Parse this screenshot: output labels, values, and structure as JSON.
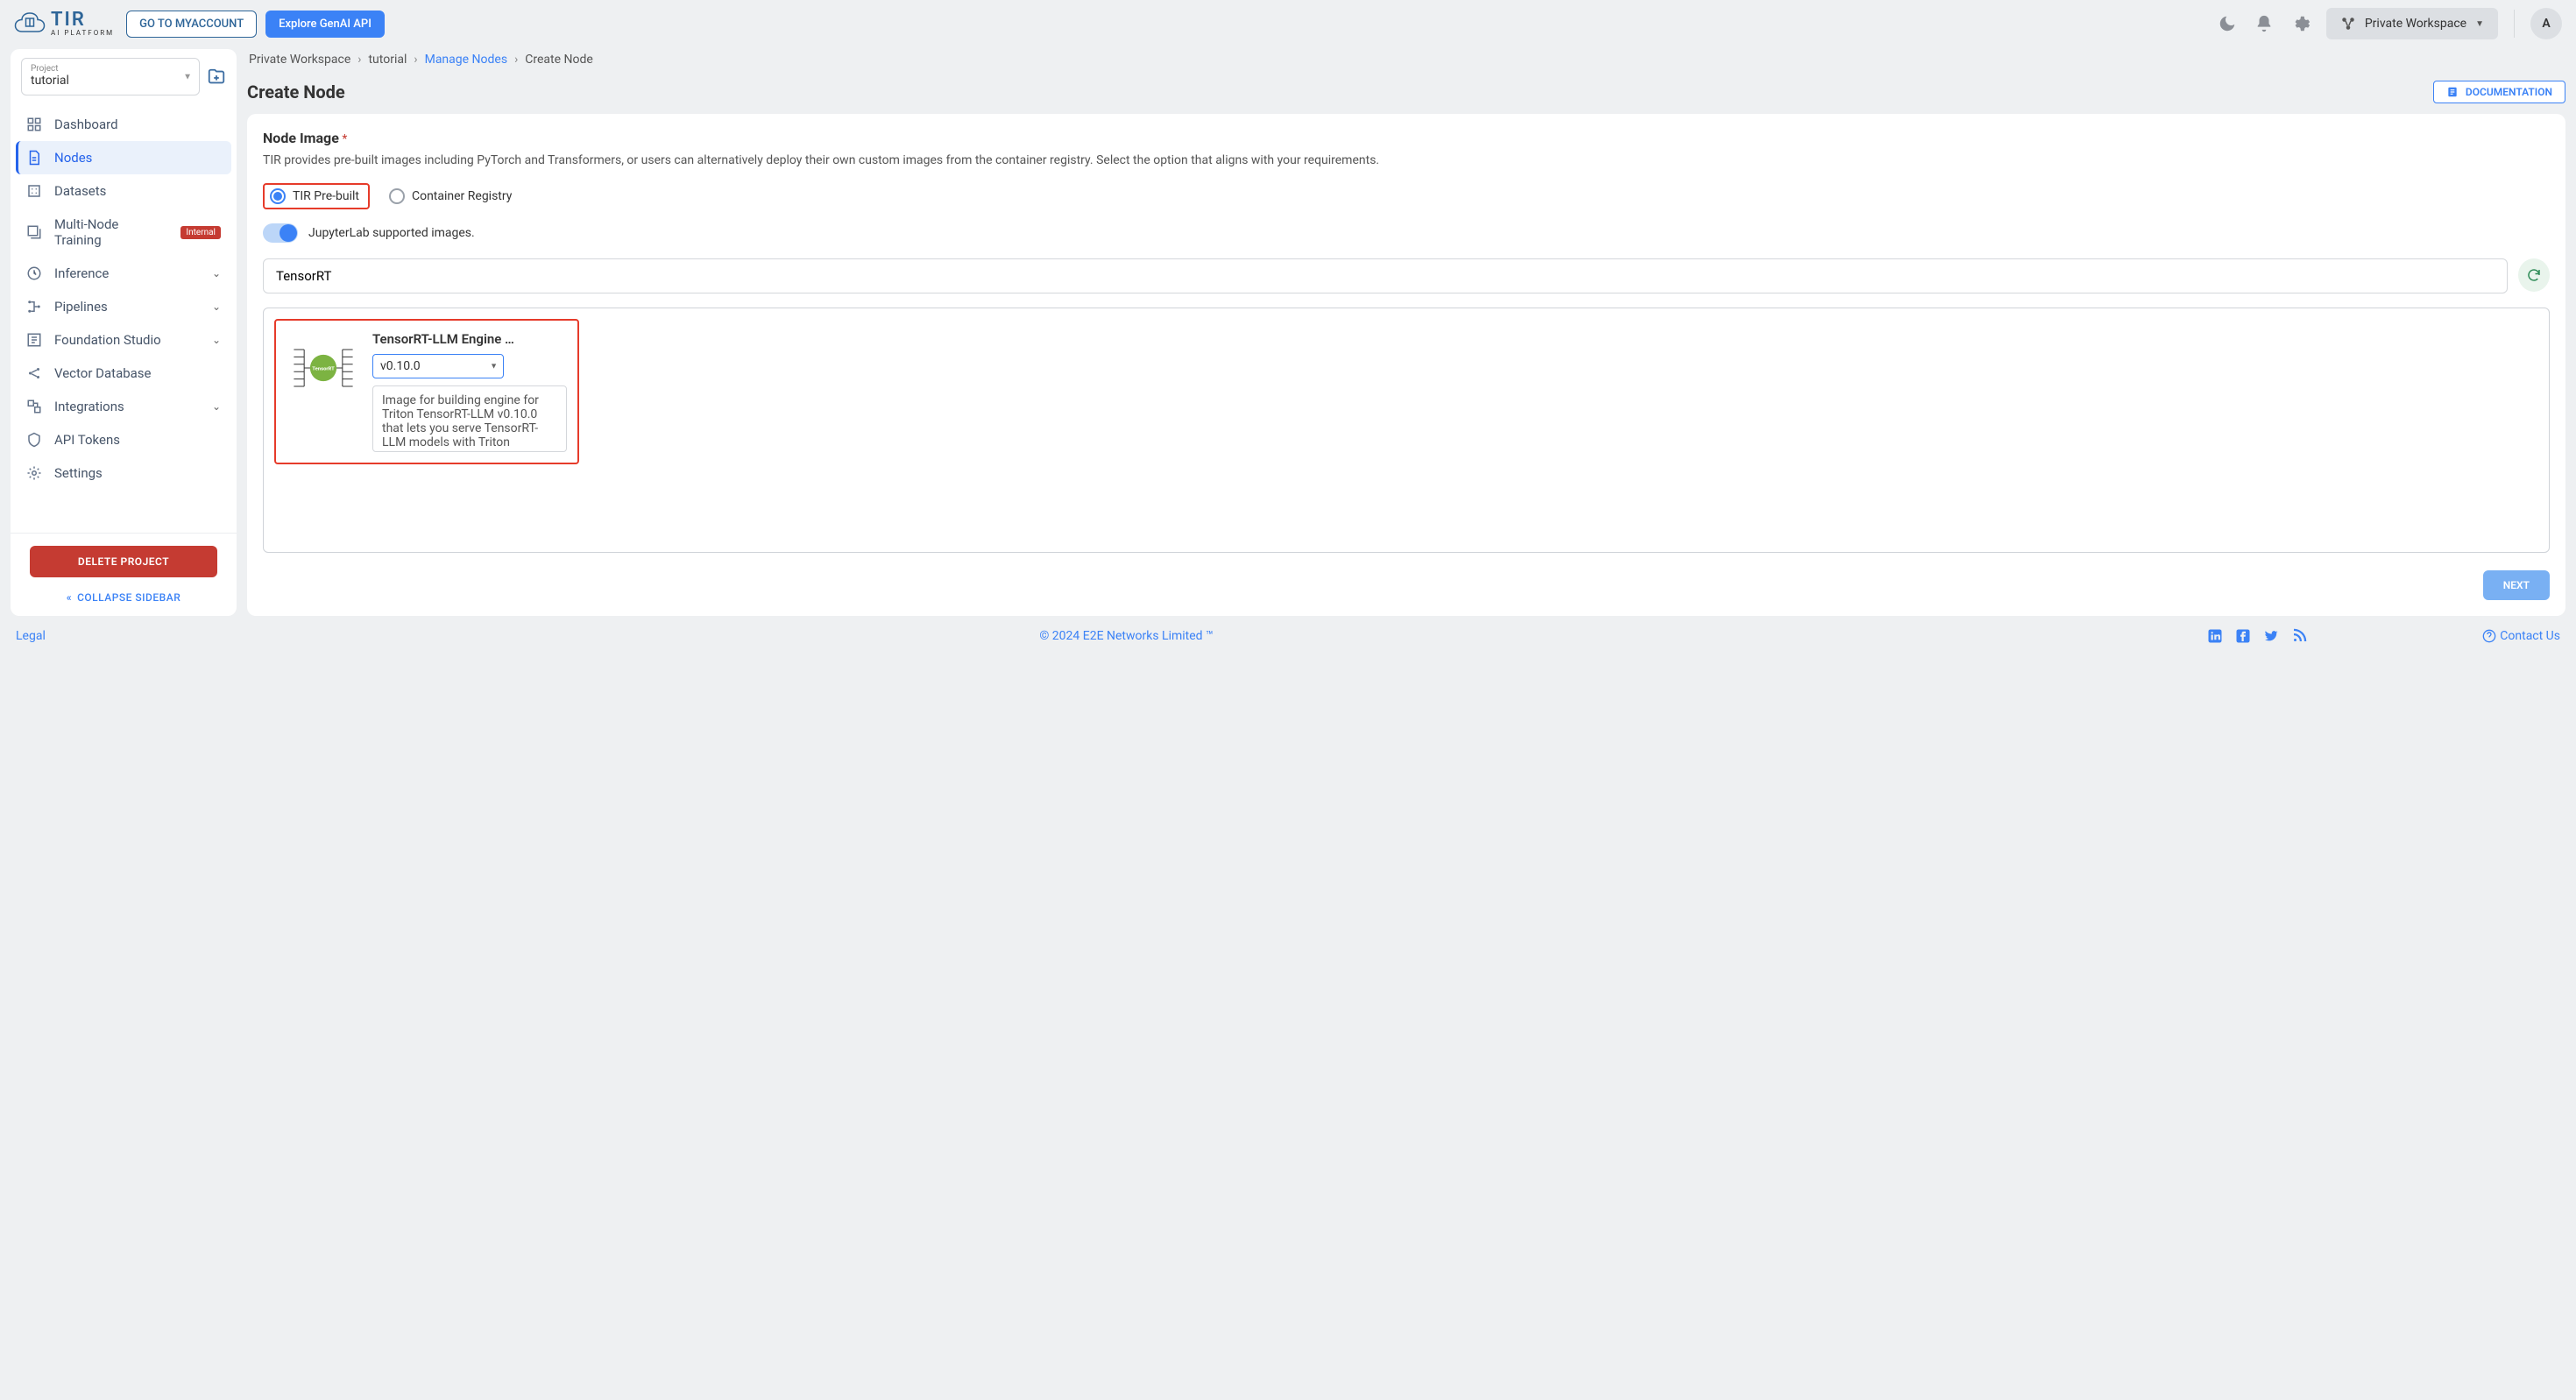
{
  "header": {
    "logo_title": "TIR",
    "logo_sub": "AI PLATFORM",
    "myaccount": "GO TO MYACCOUNT",
    "explore": "Explore GenAI API",
    "workspace": "Private Workspace",
    "avatar": "A"
  },
  "sidebar": {
    "project_label": "Project",
    "project_value": "tutorial",
    "items": [
      {
        "label": "Dashboard"
      },
      {
        "label": "Nodes"
      },
      {
        "label": "Datasets"
      },
      {
        "label": "Multi-Node Training",
        "badge": "Internal"
      },
      {
        "label": "Inference",
        "caret": true
      },
      {
        "label": "Pipelines",
        "caret": true
      },
      {
        "label": "Foundation Studio",
        "caret": true
      },
      {
        "label": "Vector Database"
      },
      {
        "label": "Integrations",
        "caret": true
      },
      {
        "label": "API Tokens"
      },
      {
        "label": "Settings"
      }
    ],
    "delete": "DELETE PROJECT",
    "collapse": "COLLAPSE SIDEBAR"
  },
  "crumbs": {
    "a": "Private Workspace",
    "b": "tutorial",
    "c": "Manage Nodes",
    "d": "Create Node"
  },
  "page": {
    "title": "Create Node",
    "doc": "DOCUMENTATION"
  },
  "section": {
    "title": "Node Image",
    "desc": "TIR provides pre-built images including PyTorch and Transformers, or users can alternatively deploy their own custom images from the container registry. Select the option that aligns with your requirements.",
    "radio_prebuilt": "TIR Pre-built",
    "radio_registry": "Container Registry",
    "toggle_label": "JupyterLab supported images.",
    "search_value": "TensorRT"
  },
  "image_card": {
    "title": "TensorRT-LLM Engine …",
    "version": "v0.10.0",
    "desc": "Image for building engine for Triton TensorRT-LLM v0.10.0 that lets you serve TensorRT-LLM models with Triton"
  },
  "next": "NEXT",
  "footer": {
    "legal": "Legal",
    "copyright": "© 2024 E2E Networks Limited ™",
    "contact": "Contact Us"
  }
}
